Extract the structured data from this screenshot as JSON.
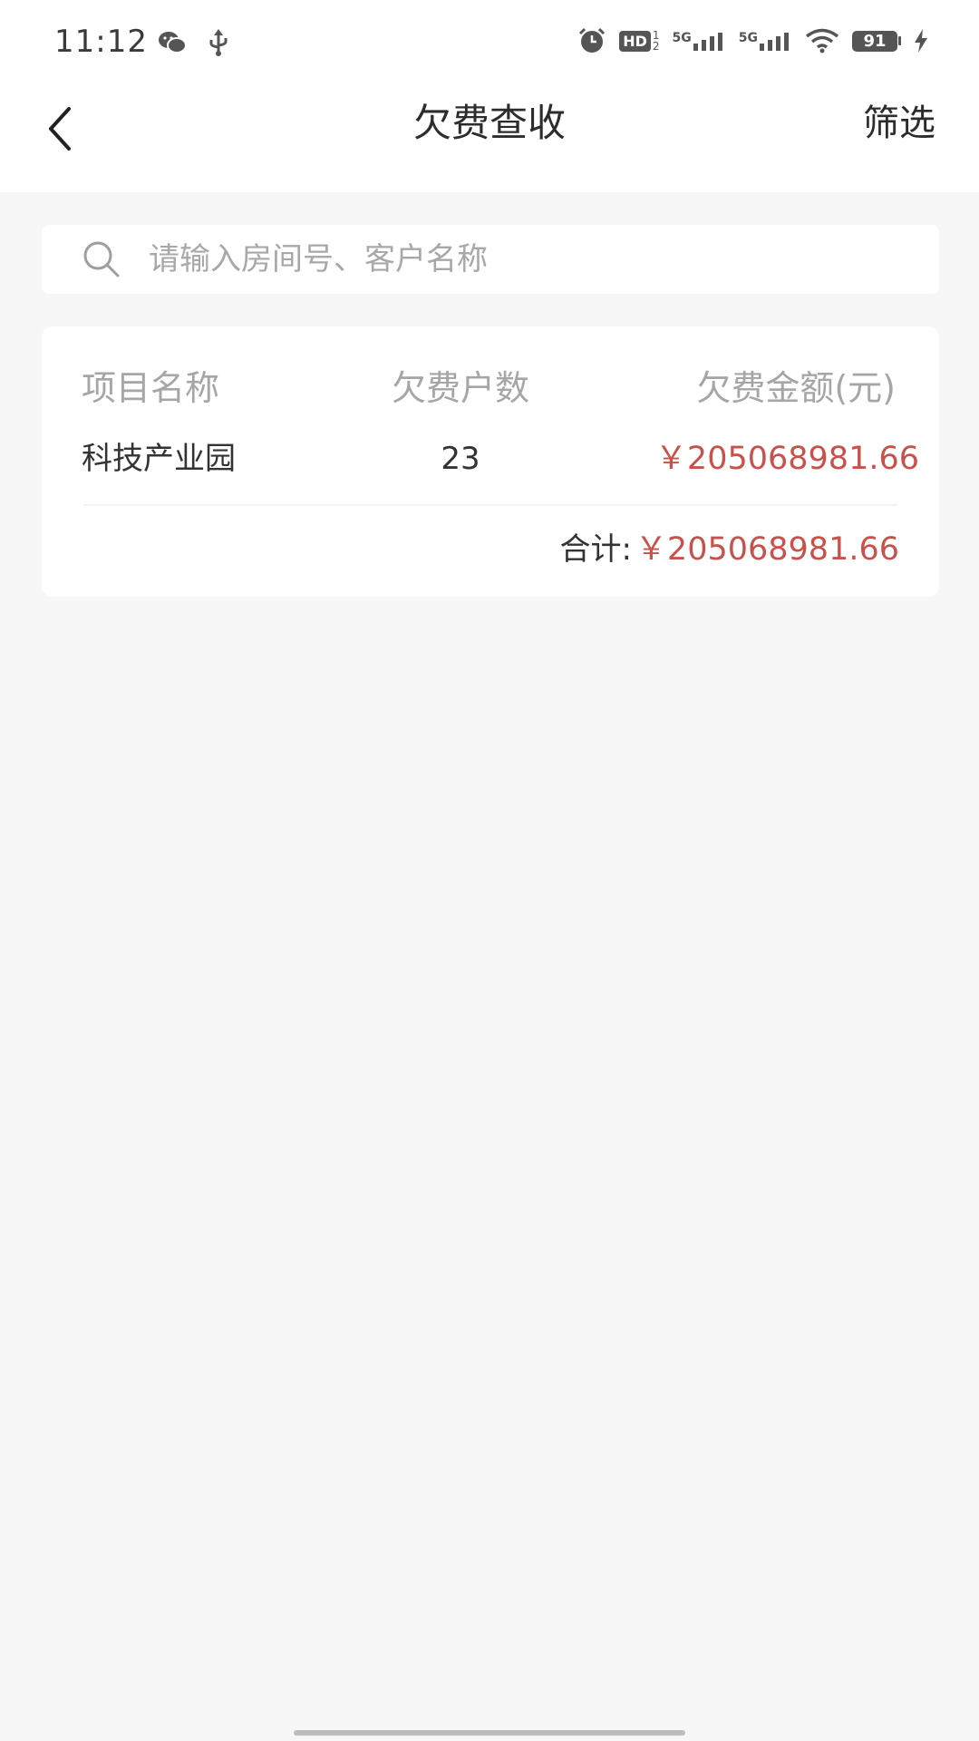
{
  "status_bar": {
    "time": "11:12",
    "network_1": "5G",
    "network_2": "5G",
    "hd_label": "HD",
    "battery": "91"
  },
  "nav": {
    "title": "欠费查收",
    "filter_label": "筛选"
  },
  "search": {
    "placeholder": "请输入房间号、客户名称",
    "value": ""
  },
  "table": {
    "headers": {
      "project_name": "项目名称",
      "households": "欠费户数",
      "amount": "欠费金额(元)"
    },
    "rows": [
      {
        "project_name": "科技产业园",
        "households": "23",
        "amount": "￥205068981.66"
      }
    ],
    "total_label": "合计:",
    "total_value": "￥205068981.66"
  },
  "colors": {
    "accent_red": "#c8524b",
    "page_bg": "#f7f7f7",
    "header_text": "#a6a6a6"
  }
}
